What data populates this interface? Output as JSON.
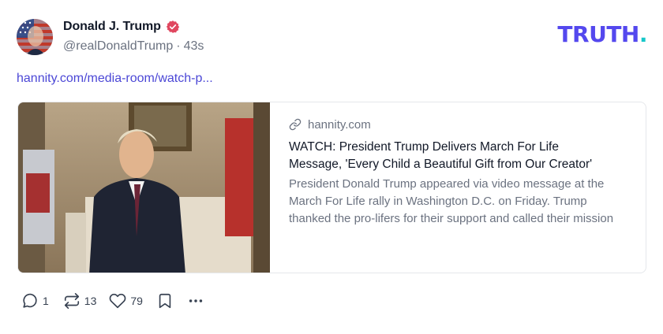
{
  "author": {
    "display_name": "Donald J. Trump",
    "handle": "@realDonaldTrump",
    "separator": "·",
    "time_ago": "43s",
    "verified": true,
    "verified_color": "#e0475f"
  },
  "brand": {
    "logo_text": "TRUTH",
    "logo_dot": ".",
    "logo_color": "#5448ee",
    "dot_color": "#16c7c9"
  },
  "post": {
    "link_text": "hannity.com/media-room/watch-p..."
  },
  "card": {
    "domain": "hannity.com",
    "title": "WATCH: President Trump Delivers March For Life Message, 'Every Child a Beautiful Gift from Our Creator'",
    "description": "President Donald Trump appeared via video message at the March For Life rally in Washington D.C. on Friday. Trump thanked the pro-lifers for their support and called their mission",
    "image_icon": "video-still-image"
  },
  "actions": {
    "replies": "1",
    "retruths": "13",
    "likes": "79"
  }
}
